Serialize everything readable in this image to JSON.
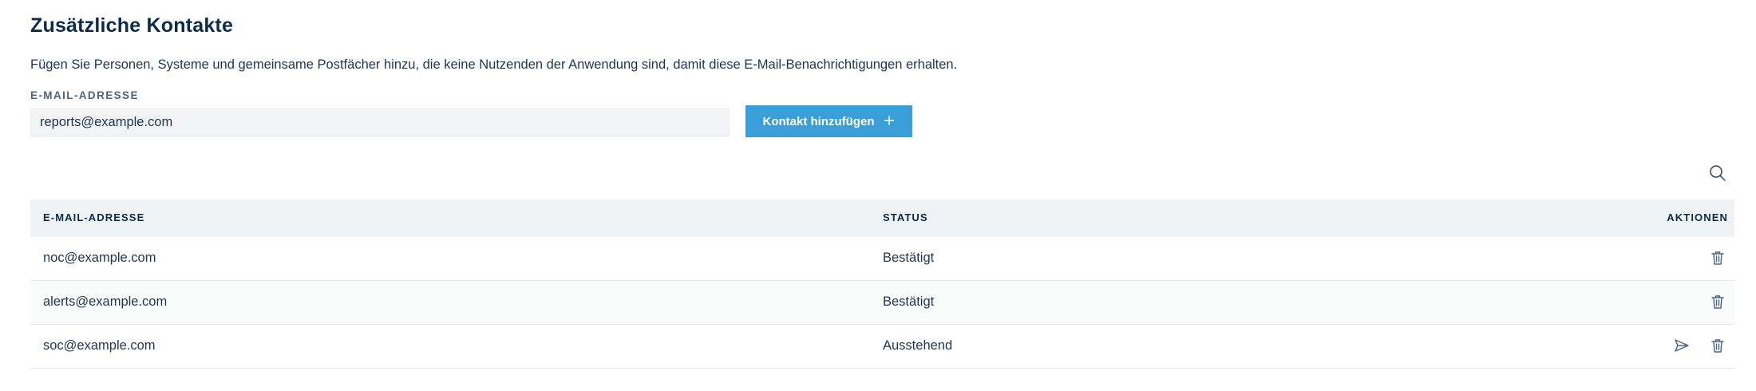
{
  "header": {
    "title": "Zusätzliche Kontakte",
    "description": "Fügen Sie Personen, Systeme und gemeinsame Postfächer hinzu, die keine Nutzenden der Anwendung sind, damit diese E-Mail-Benachrichtigungen erhalten."
  },
  "form": {
    "email_label": "E-MAIL-ADRESSE",
    "email_value": "reports@example.com",
    "add_button_label": "Kontakt hinzufügen",
    "add_button_icon": "plus-icon"
  },
  "table": {
    "search_icon": "search-icon",
    "columns": {
      "email": "E-MAIL-ADRESSE",
      "status": "STATUS",
      "actions": "AKTIONEN"
    },
    "rows": [
      {
        "email": "noc@example.com",
        "status": "Bestätigt",
        "actions": [
          "trash-icon"
        ]
      },
      {
        "email": "alerts@example.com",
        "status": "Bestätigt",
        "actions": [
          "trash-icon"
        ]
      },
      {
        "email": "soc@example.com",
        "status": "Ausstehend",
        "actions": [
          "send-icon",
          "trash-icon"
        ]
      }
    ]
  },
  "colors": {
    "accent": "#3a9ed8",
    "heading": "#0b2b4a",
    "text": "#1f3550",
    "header_bg": "#f0f3f6",
    "input_bg": "#f2f3f5"
  }
}
